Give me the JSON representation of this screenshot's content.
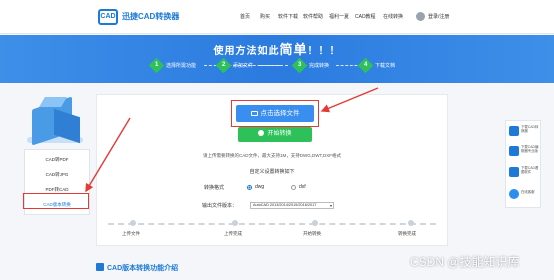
{
  "header": {
    "logo_text": "CAD",
    "app_name": "迅捷CAD转换器",
    "nav": [
      "首页",
      "购买",
      "软件下载",
      "软件帮助",
      "福利一夏",
      "CAD教程",
      "在线转换"
    ],
    "login": "登录/注册"
  },
  "banner": {
    "title_prefix": "使用方法如此",
    "title_big": "简单",
    "title_suffix": "！！！",
    "steps": [
      {
        "num": "1",
        "label": "选择所需功能"
      },
      {
        "num": "2",
        "label": "添加文件"
      },
      {
        "num": "3",
        "label": "完成转换"
      },
      {
        "num": "4",
        "label": "下载文档"
      }
    ]
  },
  "sidebar": {
    "items": [
      {
        "label": "CAD转PDF"
      },
      {
        "label": "CAD转JPG"
      },
      {
        "label": "PDF转CAD"
      },
      {
        "label": "CAD版本转换"
      }
    ]
  },
  "main": {
    "select_button": "点击选择文件",
    "start_button": "开始转换",
    "hint": "请上传需要转换的CAD文件，最大支持1M，支持DWG,DWT,DXF格式",
    "custom_title": "自定义设置转换如下",
    "format_label": "转换格式",
    "format_options": [
      "dwg",
      "dxf"
    ],
    "format_selected": "dwg",
    "version_label": "输出文件版本：",
    "version_value": "AutoCAD 2013/2014/2015/2016/2017",
    "progress_labels": [
      "上传文件",
      "上传完成",
      "开始转换",
      "转换完成"
    ]
  },
  "right_bar": {
    "items": [
      {
        "label": "下载CAD转换器"
      },
      {
        "label": "下载CAD编辑器专业版"
      },
      {
        "label": "下载CAD看图软件"
      },
      {
        "label": "在线客服"
      }
    ]
  },
  "footer": {
    "intro_title": "CAD版本转换功能介绍"
  },
  "watermark": "CSDN @技能知识库",
  "colors": {
    "primary": "#1e7ad6",
    "banner": "#2b7be0",
    "button_blue": "#3a8ef0",
    "button_green": "#2ec15a",
    "highlight_red": "#e53935"
  }
}
